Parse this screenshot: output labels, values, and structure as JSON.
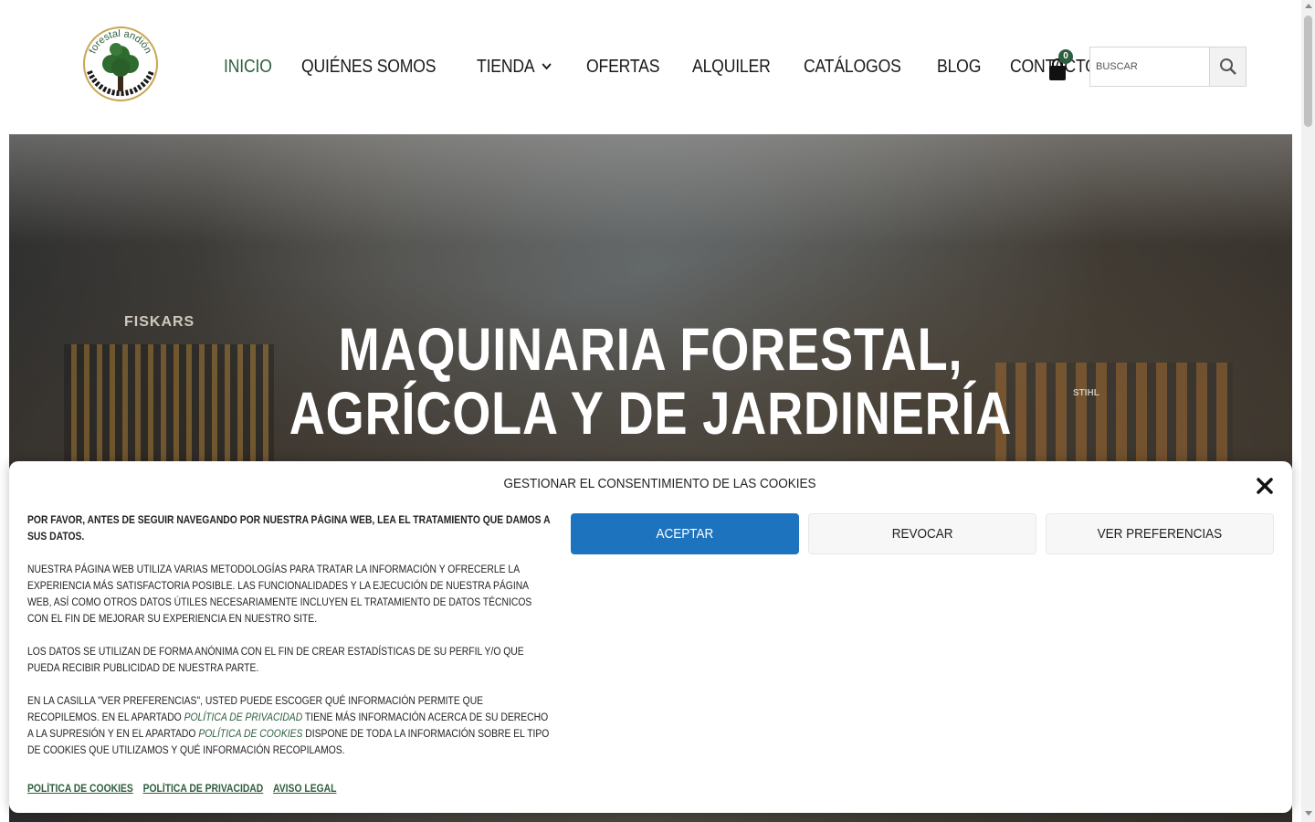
{
  "header": {
    "logo_text": "forestal andión",
    "nav": [
      {
        "label": "INICIO",
        "active": true
      },
      {
        "label": "QUIÉNES SOMOS"
      },
      {
        "label": "TIENDA",
        "has_dropdown": true
      },
      {
        "label": "OFERTAS"
      },
      {
        "label": "ALQUILER"
      },
      {
        "label": "CATÁLOGOS"
      },
      {
        "label": "BLOG"
      },
      {
        "label": "CONTACTO"
      }
    ],
    "cart_count": "0",
    "search_placeholder": "BUSCAR"
  },
  "hero": {
    "title_line1": "MAQUINARIA FORESTAL,",
    "title_line2": "AGRÍCOLA Y DE JARDINERÍA",
    "brand_left": "FISKARS",
    "brand_right": "STIHL"
  },
  "cookie": {
    "title": "GESTIONAR EL CONSENTIMIENTO DE LAS COOKIES",
    "p1": "POR FAVOR, ANTES DE SEGUIR NAVEGANDO POR NUESTRA PÁGINA WEB, LEA EL TRATAMIENTO QUE DAMOS A SUS DATOS.",
    "p2": "NUESTRA PÁGINA WEB UTILIZA VARIAS METODOLOGÍAS PARA TRATAR LA INFORMACIÓN Y OFRECERLE LA EXPERIENCIA MÁS SATISFACTORIA POSIBLE. LAS FUNCIONALIDADES Y LA EJECUCIÓN DE NUESTRA PÁGINA WEB, ASÍ COMO OTROS DATOS ÚTILES NECESARIAMENTE INCLUYEN EL TRATAMIENTO DE DATOS TÉCNICOS CON EL FIN DE MEJORAR SU EXPERIENCIA EN NUESTRO SITE.",
    "p3": "LOS DATOS SE UTILIZAN DE FORMA ANÓNIMA CON EL FIN DE CREAR ESTADÍSTICAS DE SU PERFIL Y/O QUE PUEDA RECIBIR PUBLICIDAD DE NUESTRA PARTE.",
    "p4_a": "EN LA CASILLA \"VER PREFERENCIAS\", USTED PUEDE ESCOGER QUÉ INFORMACIÓN PERMITE QUE RECOPILEMOS. EN EL APARTADO ",
    "p4_link1": "POLÍTICA DE PRIVACIDAD",
    "p4_b": " TIENE MÁS INFORMACIÓN ACERCA DE SU DERECHO A LA SUPRESIÓN Y EN EL APARTADO ",
    "p4_link2": "POLÍTICA DE COOKIES",
    "p4_c": " DISPONE DE TODA LA INFORMACIÓN SOBRE EL TIPO DE COOKIES QUE UTILIZAMOS Y QUÉ INFORMACIÓN RECOPILAMOS.",
    "buttons": {
      "accept": "ACEPTAR",
      "revoke": "REVOCAR",
      "prefs": "VER PREFERENCIAS"
    },
    "links": [
      "POLÍTICA DE COOKIES",
      "POLÍTICA DE PRIVACIDAD",
      "AVISO LEGAL"
    ]
  },
  "colors": {
    "brand_green": "#2e5e3e",
    "accept_blue": "#1e73be"
  }
}
